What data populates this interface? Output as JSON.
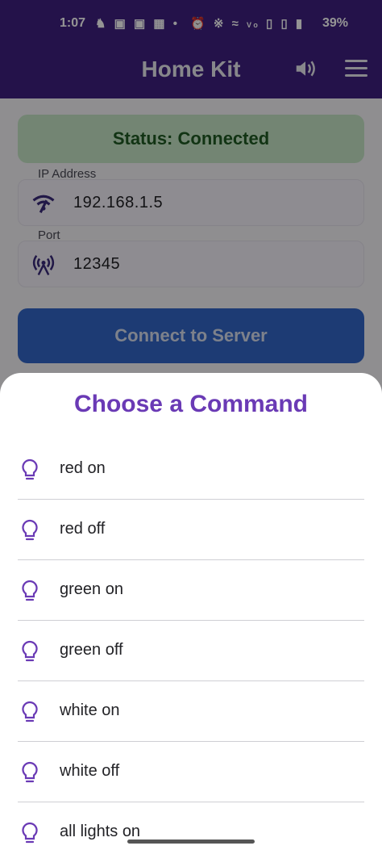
{
  "status_bar": {
    "time": "1:07",
    "left_icons": [
      "snapchat-icon",
      "instagram-icon",
      "instagram-icon",
      "app-icon",
      "dot-icon"
    ],
    "right_icons": [
      "alarm-icon",
      "bluetooth-icon",
      "wifi-icon",
      "volte-icon",
      "signal-icon",
      "signal-icon",
      "battery-icon"
    ],
    "battery": "39%"
  },
  "app_bar": {
    "title": "Home Kit",
    "background": "#3f2080"
  },
  "status_card": {
    "text": "Status: Connected",
    "background": "#c6e6c6",
    "text_color": "#1f5a23"
  },
  "ip_field": {
    "label": "IP Address",
    "value": "192.168.1.5",
    "icon": "wifi-icon"
  },
  "port_field": {
    "label": "Port",
    "value": "12345",
    "icon": "antenna-icon"
  },
  "connect_button": {
    "label": "Connect to Server",
    "background": "#3367c8"
  },
  "sheet": {
    "title": "Choose a Command",
    "title_color": "#6a3ab5",
    "commands": [
      {
        "label": "red on",
        "icon": "lightbulb-icon"
      },
      {
        "label": "red off",
        "icon": "lightbulb-icon"
      },
      {
        "label": "green on",
        "icon": "lightbulb-icon"
      },
      {
        "label": "green off",
        "icon": "lightbulb-icon"
      },
      {
        "label": "white on",
        "icon": "lightbulb-icon"
      },
      {
        "label": "white off",
        "icon": "lightbulb-icon"
      },
      {
        "label": "all lights on",
        "icon": "lightbulb-icon"
      }
    ]
  }
}
